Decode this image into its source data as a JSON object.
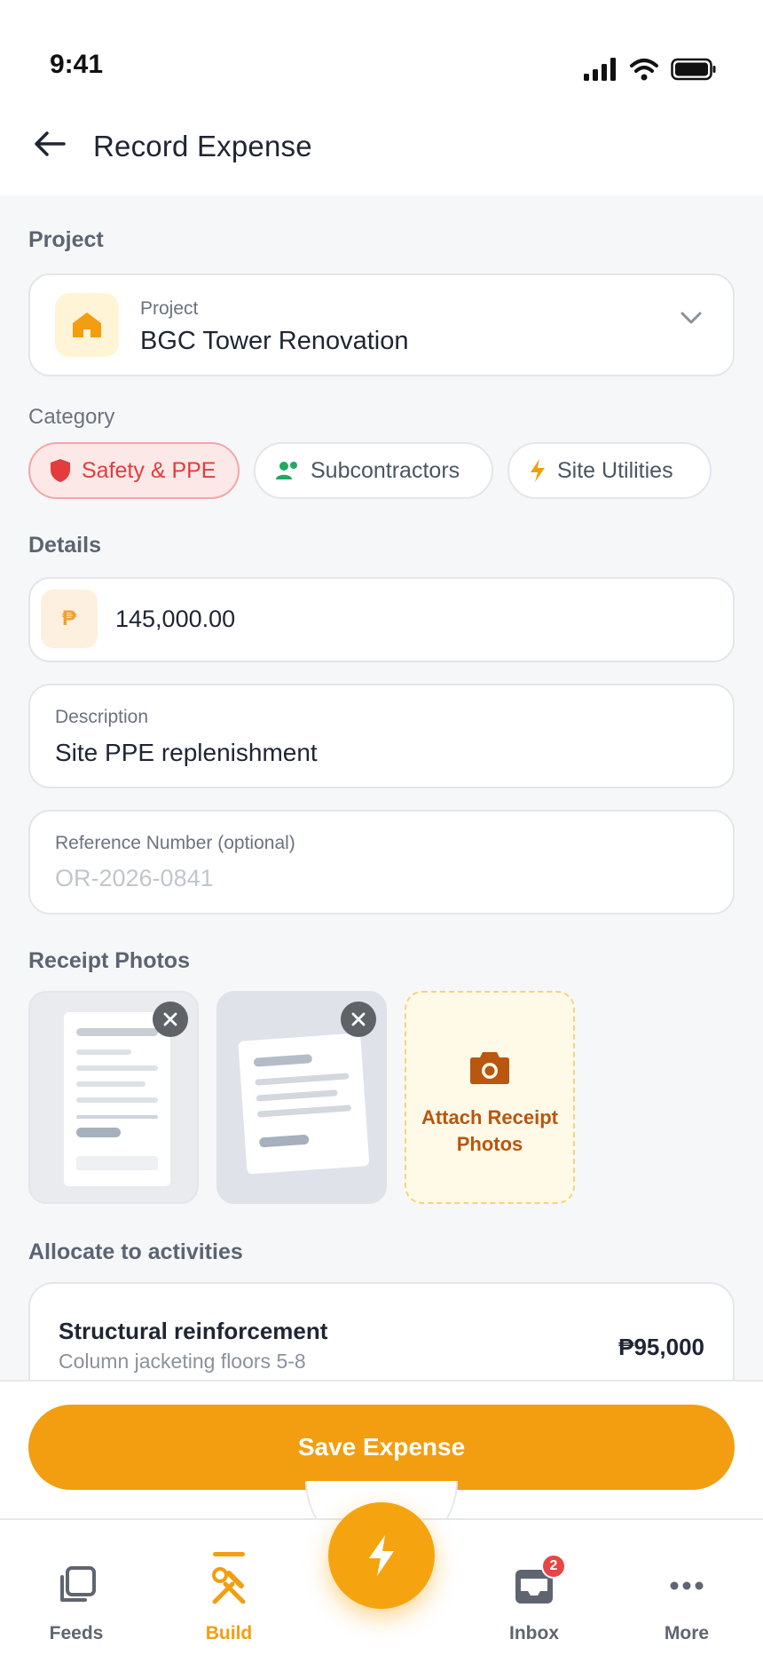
{
  "status_bar": {
    "time": "9:41"
  },
  "header": {
    "title": "Record Expense"
  },
  "project_section": {
    "heading": "Project",
    "field_label": "Project",
    "value": "BGC Tower Renovation"
  },
  "category": {
    "heading": "Category",
    "chips": [
      {
        "label": "Safety & PPE",
        "icon": "shield-icon",
        "color": "#e23c3c",
        "selected": true
      },
      {
        "label": "Subcontractors",
        "icon": "people-icon",
        "color": "#22a861",
        "selected": false
      },
      {
        "label": "Site Utilities",
        "icon": "bolt-icon",
        "color": "#f29e10",
        "selected": false
      }
    ]
  },
  "details": {
    "heading": "Details",
    "currency_symbol": "₱",
    "amount": "145,000.00",
    "description_label": "Description",
    "description_value": "Site PPE replenishment",
    "reference_label": "Reference Number (optional)",
    "reference_placeholder": "OR-2026-0841"
  },
  "receipts": {
    "heading": "Receipt Photos",
    "attach_label": "Attach Receipt Photos",
    "photo_count": 2
  },
  "allocation": {
    "heading": "Allocate to activities",
    "items": [
      {
        "title": "Structural reinforcement",
        "subtitle": "Column jacketing floors 5-8",
        "amount": "₱95,000"
      }
    ]
  },
  "actions": {
    "save_label": "Save Expense"
  },
  "bottom_nav": {
    "items": [
      {
        "label": "Feeds",
        "icon": "feeds-icon",
        "active": false
      },
      {
        "label": "Build",
        "icon": "tools-icon",
        "active": true
      },
      {
        "label": "Inbox",
        "icon": "inbox-icon",
        "active": false,
        "badge": "2"
      },
      {
        "label": "More",
        "icon": "more-icon",
        "active": false
      }
    ],
    "fab_icon": "bolt-icon"
  },
  "colors": {
    "accent": "#f29e10",
    "danger": "#e23c3c",
    "success": "#22a861",
    "attach_text": "#b9560f"
  }
}
